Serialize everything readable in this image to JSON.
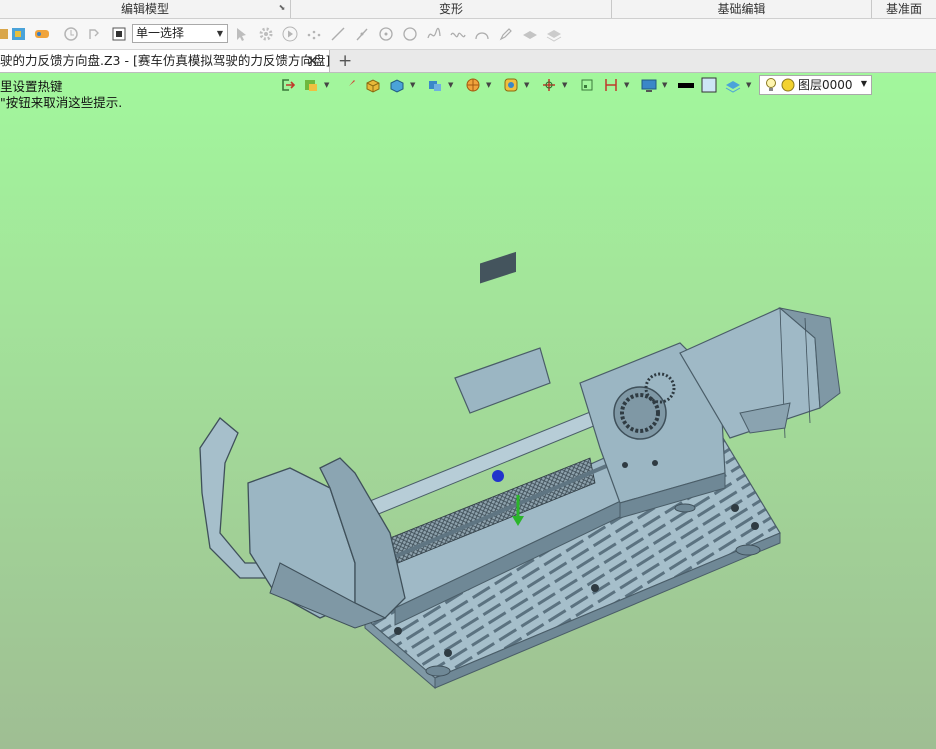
{
  "ribbon": {
    "groups": [
      "编辑模型",
      "变形",
      "基础编辑",
      "基准面"
    ],
    "selection_mode": "单一选择"
  },
  "document": {
    "tab_title": "驶的力反馈方向盘.Z3 - [赛车仿真模拟驾驶的力反馈方向盘]",
    "close_glyph": "✕",
    "add_glyph": "+"
  },
  "viewport": {
    "hint_line1": "里设置热键",
    "hint_line2": "\"按钮来取消这些提示.",
    "layer_name": "图层0000",
    "colors": {
      "bg_top": "#a2f79c",
      "bg_bottom": "#9fbe93",
      "model_fill": "#9bb6c3",
      "model_dark": "#5e7684"
    }
  },
  "icons": {
    "tool_row": [
      "shape-icon",
      "color-icon",
      "pipeline-icon",
      "filter-icon",
      "pick-icon",
      "stop-icon",
      "cursor-icon",
      "gear-icon",
      "play-icon",
      "points-icon",
      "line-icon",
      "slash-icon",
      "circle-point-icon",
      "circle-icon",
      "spline-icon",
      "wave-icon",
      "arc-icon",
      "pen-icon",
      "layer-a-icon",
      "layer-b-icon"
    ],
    "view_bar": [
      "exit-icon",
      "assembly-icon",
      "brush-icon",
      "box-icon",
      "cube-icon",
      "cubes-icon",
      "render-icon",
      "view-icon",
      "axis-icon",
      "pan-icon",
      "ruler-icon",
      "monitor-icon",
      "black-color-icon",
      "square-icon",
      "layer-icon",
      "bulb-icon",
      "dot-icon"
    ]
  }
}
